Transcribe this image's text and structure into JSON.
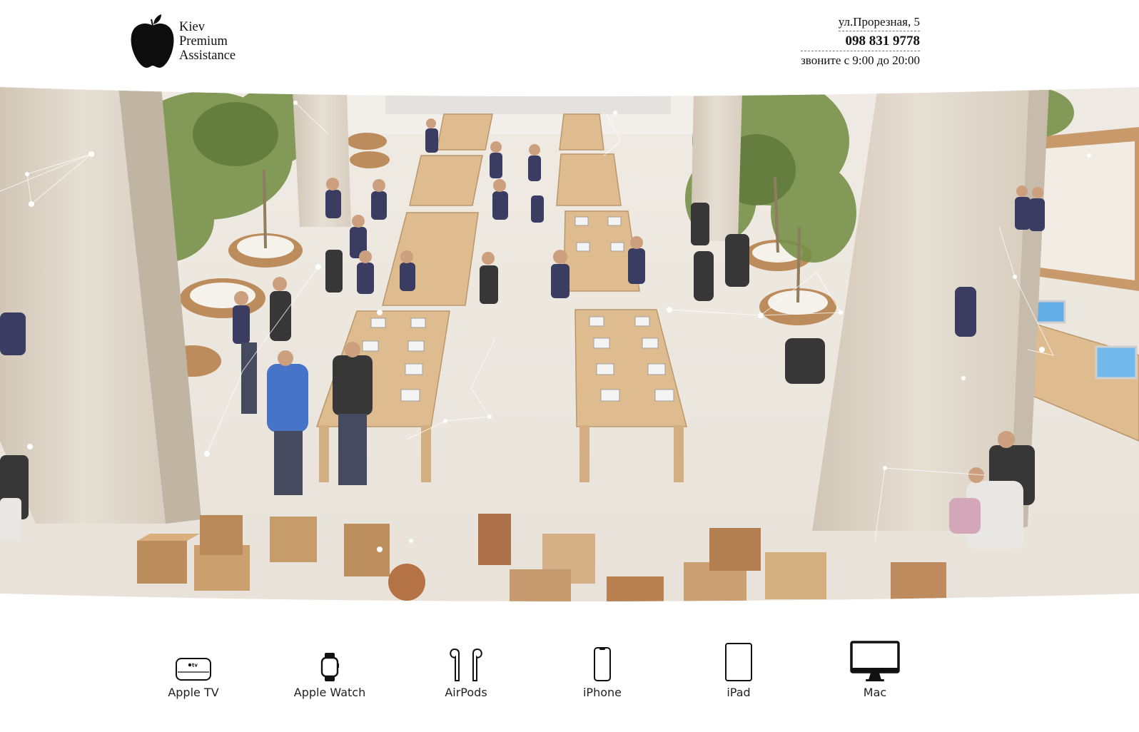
{
  "brand": {
    "line1": "Kiev",
    "line2": "Premium",
    "line3": "Assistance",
    "logo_icon": "apple-icon"
  },
  "contact": {
    "address": "ул.Прорезная, 5",
    "phone": "098 831 9778",
    "hours": "звоните с 9:00 до 20:00"
  },
  "hero": {
    "image": "apple-store-interior-photo"
  },
  "devices": [
    {
      "label": "Apple TV",
      "icon": "apple-tv-icon"
    },
    {
      "label": "Apple Watch",
      "icon": "apple-watch-icon"
    },
    {
      "label": "AirPods",
      "icon": "airpods-icon"
    },
    {
      "label": "iPhone",
      "icon": "iphone-icon"
    },
    {
      "label": "iPad",
      "icon": "ipad-icon"
    },
    {
      "label": "Mac",
      "icon": "mac-icon"
    }
  ],
  "colors": {
    "text": "#111111",
    "floor": "#ece8e1",
    "wood": "#d8b383",
    "pillar": "#ddd3c4",
    "staff_shirt": "#2e3158"
  }
}
